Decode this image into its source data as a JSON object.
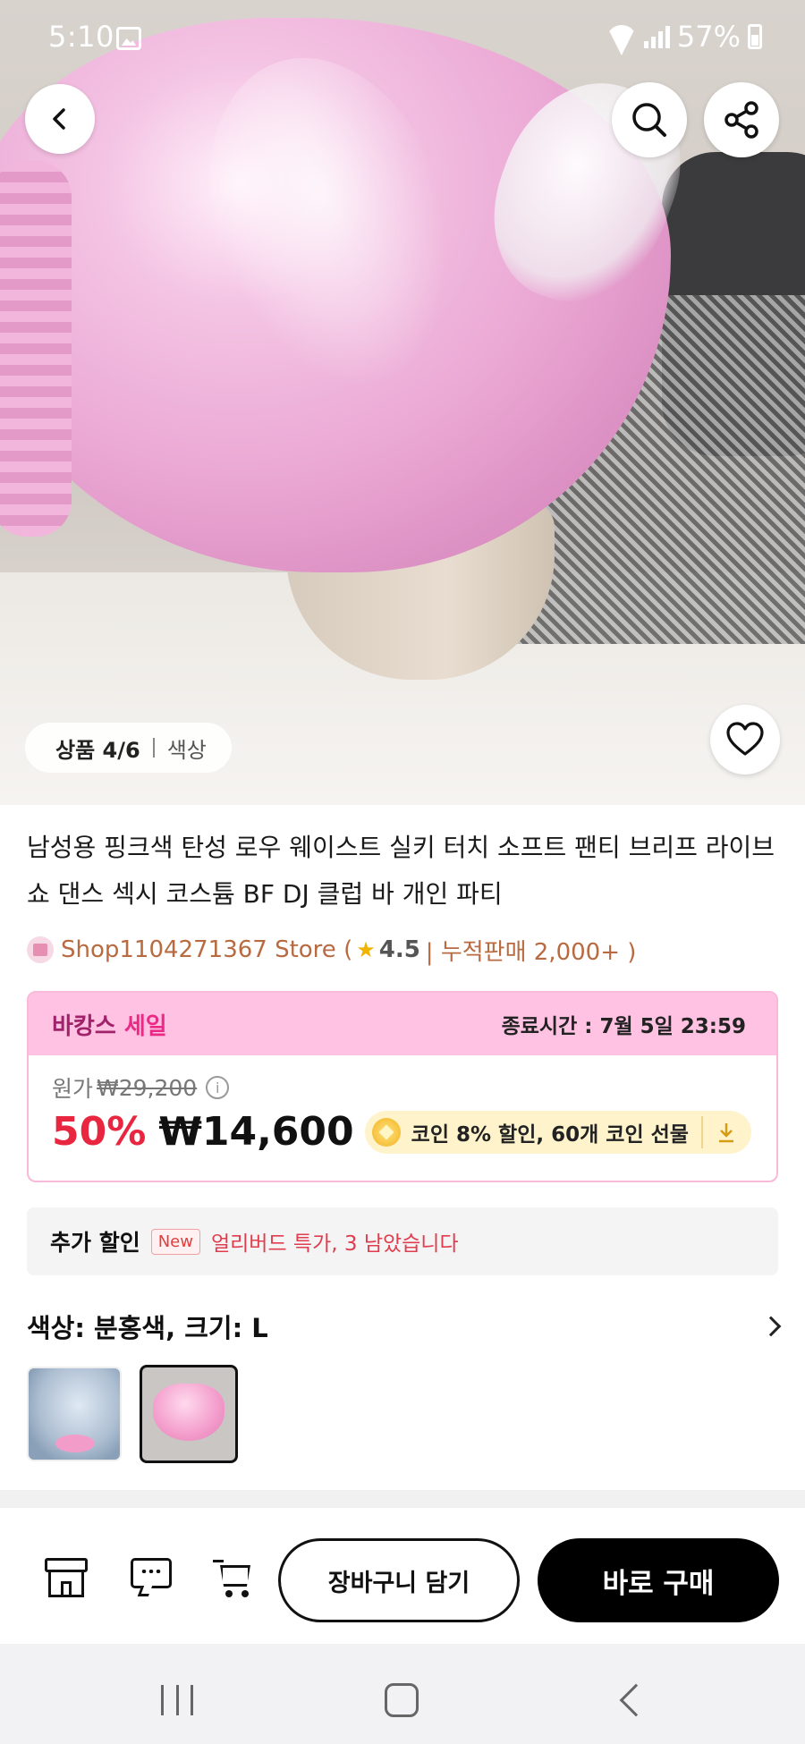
{
  "status_bar": {
    "time": "5:10",
    "battery": "57%",
    "icons": [
      "gallery-icon",
      "wifi-icon",
      "signal-icon",
      "battery-icon"
    ]
  },
  "header": {
    "back_icon": "chevron-left-icon",
    "search_icon": "search-icon",
    "share_icon": "share-icon"
  },
  "gallery": {
    "counter": "상품 4/6",
    "counter_tab": "색상",
    "favorite_icon": "heart-icon"
  },
  "product": {
    "title": "남성용 핑크색 탄성 로우 웨이스트 실키 터치 소프트 팬티 브리프 라이브 쇼 댄스 섹시 코스튬 BF DJ 클럽 바 개인 파티",
    "store_name": "Shop1104271367 Store (",
    "rating": "4.5",
    "sales": "| 누적판매 2,000+ )"
  },
  "sale": {
    "label_prefix": "바캉스",
    "label_accent": "세일",
    "end_time": "종료시간 :  7월 5일 23:59",
    "original_label": "원가",
    "original_price": "₩29,200",
    "discount_pct": "50%",
    "price": "₩14,600",
    "coin_text": "코인 8% 할인,  60개 코인 선물"
  },
  "extra_discount": {
    "label": "추가 할인",
    "badge": "New",
    "text": "얼리버드 특가, 3 남았습니다"
  },
  "variant": {
    "label": "색상: 분홍색, 크기: L",
    "thumbnails": [
      "하늘색",
      "분홍색"
    ],
    "selected_index": 1
  },
  "actions": {
    "icons": [
      "store-icon",
      "chat-icon",
      "cart-icon"
    ],
    "add_to_cart": "장바구니 담기",
    "buy_now": "바로 구매"
  },
  "colors": {
    "sale_header_bg": "#ffc2e2",
    "price_red": "#e8263f",
    "store_brown": "#b86a40",
    "coin_pill_bg": "#fff3cc",
    "buy_button_bg": "#000000"
  }
}
